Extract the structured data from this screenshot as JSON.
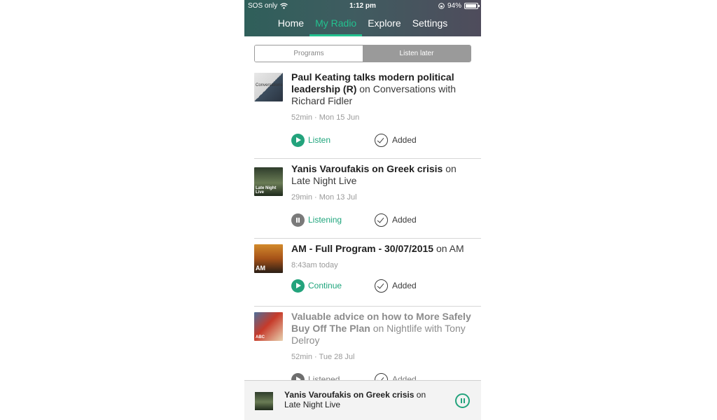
{
  "statusbar": {
    "carrier": "SOS only",
    "time": "1:12 pm",
    "battery": "94%"
  },
  "nav": {
    "tabs": [
      {
        "label": "Home",
        "active": false
      },
      {
        "label": "My Radio",
        "active": true
      },
      {
        "label": "Explore",
        "active": false
      },
      {
        "label": "Settings",
        "active": false
      }
    ]
  },
  "segmented": {
    "programs": "Programs",
    "listen_later": "Listen later",
    "selected": "Listen later"
  },
  "items": [
    {
      "title": "Paul Keating talks modern political leadership (R)",
      "on": "on",
      "program": "Conversations with Richard Fidler",
      "meta": "52min · Mon 15 Jun",
      "action": "Listen",
      "added": "Added",
      "thumb_label": "Conversations"
    },
    {
      "title": "Yanis Varoufakis on Greek crisis",
      "on": "on",
      "program": "Late Night Live",
      "meta": "29min · Mon 13 Jul",
      "action": "Listening",
      "added": "Added",
      "thumb_label": "Late Night Live"
    },
    {
      "title": "AM - Full Program - 30/07/2015",
      "on": "on",
      "program": "AM",
      "meta": "8:43am today",
      "action": "Continue",
      "added": "Added",
      "thumb_label": "AM"
    },
    {
      "title": "Valuable advice on how to More Safely Buy Off The Plan",
      "on": "on",
      "program": "Nightlife with Tony Delroy",
      "meta": "52min · Tue 28 Jul",
      "action": "Listened",
      "added": "Added",
      "thumb_label": "ABC"
    }
  ],
  "miniplayer": {
    "title": "Yanis Varoufakis on Greek crisis",
    "on": "on",
    "program": "Late Night Live"
  },
  "colors": {
    "accent": "#23a37c",
    "active_tab": "#23c18f"
  }
}
